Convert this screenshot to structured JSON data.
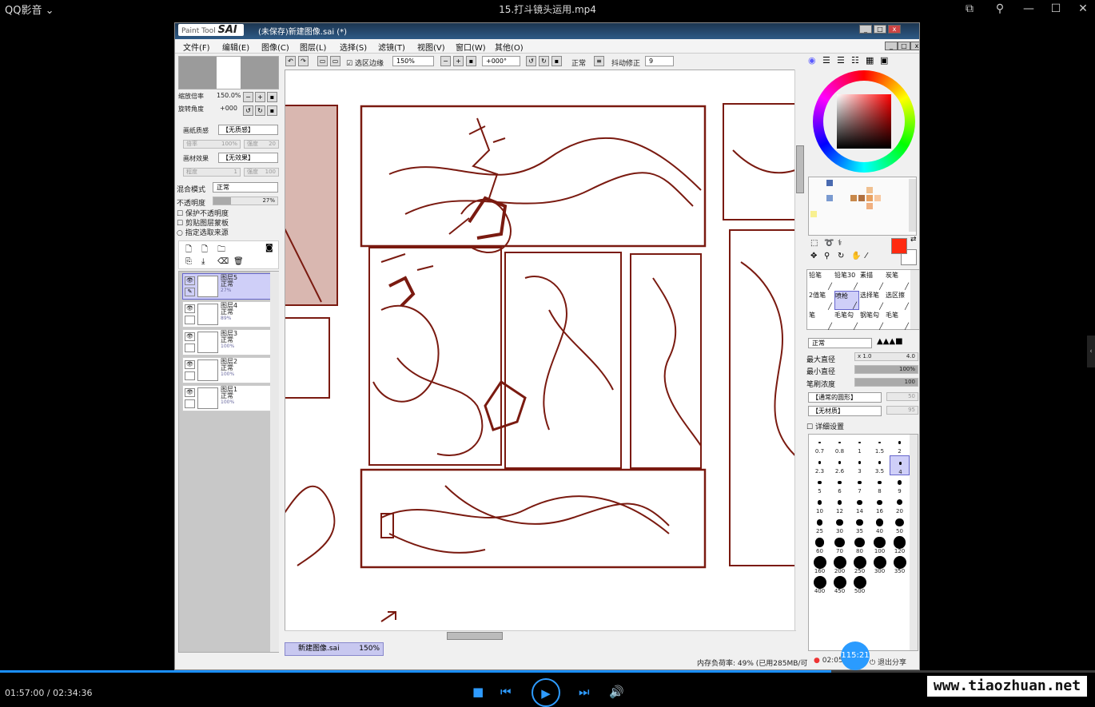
{
  "player": {
    "brand": "QQ影音",
    "title": "15.打斗镜头运用.mp4",
    "time": "01:57:00 / 02:34:36",
    "progress": 0.7594,
    "watermark": "www.tiaozhuan.net"
  },
  "sai": {
    "logo_small": "Paint Tool",
    "logo": "SAI",
    "doc_title": "(未保存)新建图像.sai (*)",
    "menus": [
      "文件(F)",
      "编辑(E)",
      "图像(C)",
      "图层(L)",
      "选择(S)",
      "滤镜(T)",
      "视图(V)",
      "窗口(W)",
      "其他(O)"
    ],
    "nav": {
      "zoom_label": "缩放倍率",
      "zoom_value": "150.0%",
      "rotate_label": "旋转角度",
      "rotate_value": "+000"
    },
    "paper": {
      "texture_label": "画纸质感",
      "texture_value": "【无质感】",
      "scale_label": "倍率",
      "scale_value": "100%",
      "strength_label": "强度",
      "strength_value": "20",
      "effect_label": "画材效果",
      "effect_value": "【无效果】",
      "degree_label": "程度",
      "degree_value": "1",
      "effect_strength_label": "强度",
      "effect_strength_value": "100"
    },
    "blend": {
      "mode_label": "混合模式",
      "mode_value": "正常",
      "opacity_label": "不透明度",
      "opacity_value": "27%",
      "opacity_fraction": 0.27
    },
    "checks": [
      "保护不透明度",
      "剪贴图层蒙板",
      "指定选取来源"
    ],
    "layers": [
      {
        "name": "图层5",
        "mode": "正常",
        "opacity": "27%",
        "selected": true
      },
      {
        "name": "图层4",
        "mode": "正常",
        "opacity": "89%",
        "selected": false
      },
      {
        "name": "图层3",
        "mode": "正常",
        "opacity": "100%",
        "selected": false
      },
      {
        "name": "图层2",
        "mode": "正常",
        "opacity": "100%",
        "selected": false
      },
      {
        "name": "图层1",
        "mode": "正常",
        "opacity": "100%",
        "selected": false
      }
    ],
    "toolbar": {
      "select_edge": "选区边缘",
      "zoom": "150%",
      "angle": "+000°",
      "mode": "正常",
      "stabilizer_label": "抖动修正",
      "stabilizer_value": "9"
    },
    "doc_tab": {
      "name": "新建图像.sai",
      "zoom": "150%"
    },
    "status": "内存负荷率: 49% (已用285MB/可",
    "tools": [
      "铅笔",
      "铅笔30",
      "素描",
      "炭笔",
      "2值笔",
      "喷枪",
      "选择笔",
      "选区擦",
      "笔",
      "毛笔勾",
      "钢笔勾",
      "毛笔"
    ],
    "brush": {
      "mode": "正常",
      "max_size_label": "最大直径",
      "max_size_mult": "x 1.0",
      "max_size_value": "4.0",
      "min_size_label": "最小直径",
      "min_size_value": "100%",
      "density_label": "笔刷浓度",
      "density_value": "100",
      "shape": "【通常的圆形】",
      "shape_strength": "50",
      "texture": "【无材质】",
      "texture_strength": "95",
      "detail_label": "详细设置"
    },
    "brush_sizes": [
      "0.7",
      "0.8",
      "1",
      "1.5",
      "2",
      "2.3",
      "2.6",
      "3",
      "3.5",
      "4",
      "5",
      "6",
      "7",
      "8",
      "9",
      "10",
      "12",
      "14",
      "16",
      "20",
      "25",
      "30",
      "35",
      "40",
      "50",
      "60",
      "70",
      "80",
      "100",
      "120",
      "160",
      "200",
      "250",
      "300",
      "350",
      "400",
      "450",
      "500"
    ],
    "brush_selected": "4",
    "colors": {
      "main": "#ff2a10",
      "sub": "#ffffff",
      "ink": "#7a1a10"
    }
  },
  "overlay": {
    "bubble_time": "115:21",
    "record_time": "02:05",
    "exit_share": "退出分享"
  }
}
